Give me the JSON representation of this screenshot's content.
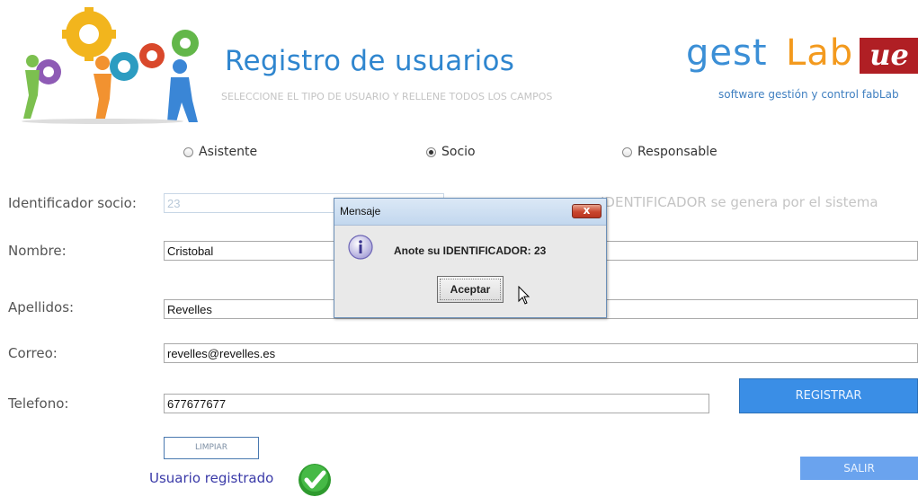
{
  "header": {
    "title": "Registro de usuarios",
    "subtitle": "SELECCIONE EL TIPO DE USUARIO Y RELLENE TODOS LOS CAMPOS",
    "brand": {
      "part1": "gest",
      "part2": "Lab",
      "badge": "ue",
      "tagline": "software gestión y control fabLab"
    }
  },
  "user_types": [
    {
      "label": "Asistente",
      "selected": false
    },
    {
      "label": "Socio",
      "selected": true
    },
    {
      "label": "Responsable",
      "selected": false
    }
  ],
  "form": {
    "id_label": "Identificador socio:",
    "id_value": "23",
    "id_note": "IDENTIFICADOR se genera por el sistema",
    "nombre_label": "Nombre:",
    "nombre_value": "Cristobal",
    "apellidos_label": "Apellidos:",
    "apellidos_value": "Revelles",
    "correo_label": "Correo:",
    "correo_value": "revelles@revelles.es",
    "telefono_label": "Telefono:",
    "telefono_value": "677677677"
  },
  "buttons": {
    "registrar": "REGISTRAR",
    "limpiar": "LIMPIAR",
    "salir": "SALIR"
  },
  "status": {
    "text": "Usuario registrado",
    "icon": "check-circle-icon"
  },
  "dialog": {
    "title": "Mensaje",
    "message": "Anote su IDENTIFICADOR: 23",
    "ok_label": "Aceptar",
    "close_label": "x",
    "icon": "info-icon"
  },
  "colors": {
    "accent": "#3a8ee6",
    "title": "#2f86cf",
    "brand_orange": "#f39a1e",
    "brand_red": "#b01f24",
    "status_green": "#2e9a2e"
  }
}
